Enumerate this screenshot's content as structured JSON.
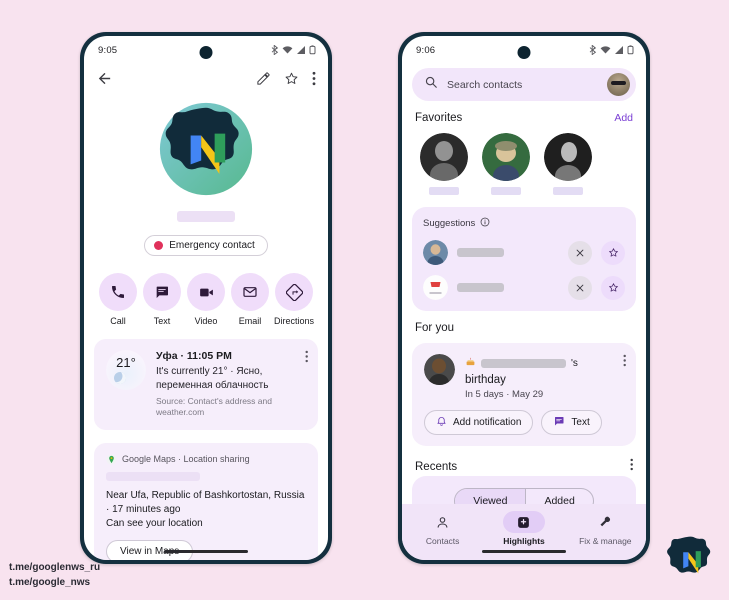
{
  "background_color": "#f8e3ef",
  "left_phone": {
    "status": {
      "time": "9:05",
      "icons": [
        "bluetooth-icon",
        "wifi-icon",
        "signal-icon",
        "battery-icon"
      ]
    },
    "topbar": {
      "back": "back-arrow-icon",
      "edit": "pencil-icon",
      "favorite": "star-icon",
      "overflow": "more-vert-icon"
    },
    "contact": {
      "avatar": "contact-avatar",
      "name_redacted": true,
      "emergency_label": "Emergency contact"
    },
    "actions": [
      {
        "label": "Call",
        "icon": "phone-icon"
      },
      {
        "label": "Text",
        "icon": "message-icon"
      },
      {
        "label": "Video",
        "icon": "videocam-icon"
      },
      {
        "label": "Email",
        "icon": "mail-icon"
      },
      {
        "label": "Directions",
        "icon": "directions-icon"
      }
    ],
    "weather_card": {
      "temperature": "21°",
      "title": "Уфа · 11:05 PM",
      "description": "It's currently 21° · Ясно, переменная облачность",
      "source": "Source: Contact's address and weather.com"
    },
    "location_card": {
      "app": "Google Maps · Location sharing",
      "name_redacted": true,
      "place": "Near Ufa, Republic of Bashkortostan, Russia · 17 minutes ago",
      "visibility": "Can see your location",
      "button": "View in Maps"
    }
  },
  "right_phone": {
    "status": {
      "time": "9:06",
      "icons": [
        "bluetooth-icon",
        "wifi-icon",
        "signal-icon",
        "battery-icon"
      ]
    },
    "search": {
      "placeholder": "Search contacts",
      "icon": "search-icon",
      "avatar": "account-avatar"
    },
    "favorites": {
      "title": "Favorites",
      "add_label": "Add",
      "count": 3
    },
    "suggestions": {
      "title": "Suggestions",
      "info_icon": "info-icon",
      "rows": [
        {
          "dismiss": "close-icon",
          "favorite": "star-icon"
        },
        {
          "dismiss": "close-icon",
          "favorite": "star-icon"
        }
      ]
    },
    "for_you": {
      "title": "For you",
      "cake_icon": "cake-icon",
      "possessive": "'s",
      "event": "birthday",
      "when": "In 5 days · May 29",
      "buttons": [
        {
          "label": "Add notification",
          "icon": "notification-icon"
        },
        {
          "label": "Text",
          "icon": "message-icon"
        }
      ],
      "overflow": "more-vert-icon"
    },
    "recents": {
      "title": "Recents",
      "overflow": "more-vert-icon",
      "tabs": [
        {
          "label": "Viewed",
          "active": true
        },
        {
          "label": "Added",
          "active": false
        }
      ]
    },
    "navigation": [
      {
        "label": "Contacts",
        "icon": "person-icon",
        "active": false
      },
      {
        "label": "Highlights",
        "icon": "highlights-icon",
        "active": true
      },
      {
        "label": "Fix & manage",
        "icon": "wrench-icon",
        "active": false
      }
    ]
  },
  "watermark": {
    "line1": "t.me/googlenws_ru",
    "line2": "t.me/google_nws",
    "logo": "news-n-logo"
  }
}
